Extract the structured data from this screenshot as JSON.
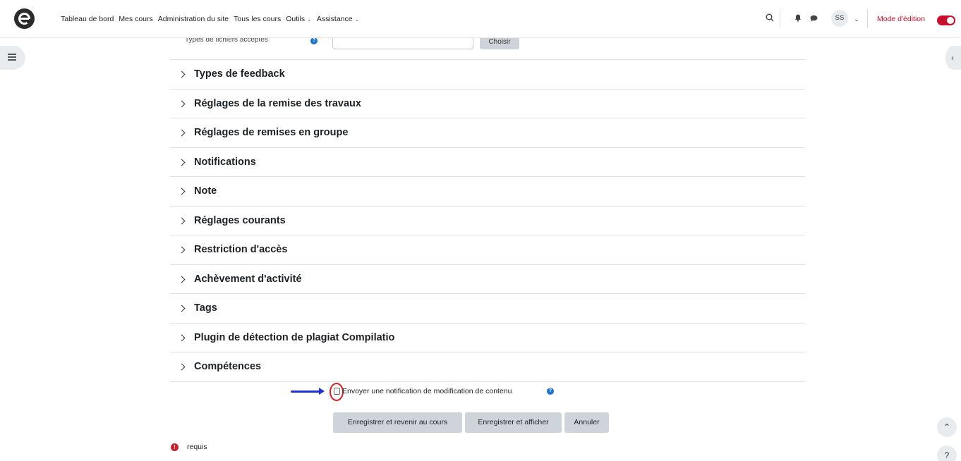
{
  "navbar": {
    "links": [
      "Tableau de bord",
      "Mes cours",
      "Administration du site",
      "Tous les cours",
      "Outils",
      "Assistance"
    ],
    "avatar_initials": "SS",
    "edit_mode_label": "Mode d'édition"
  },
  "partial_field": {
    "label": "Types de fichiers acceptés",
    "button_label": "Choisir"
  },
  "sections": [
    "Types de feedback",
    "Réglages de la remise des travaux",
    "Réglages de remises en groupe",
    "Notifications",
    "Note",
    "Réglages courants",
    "Restriction d'accès",
    "Achèvement d'activité",
    "Tags",
    "Plugin de détection de plagiat Compilatio",
    "Compétences"
  ],
  "notify": {
    "label": "Envoyer une notification de modification de contenu"
  },
  "actions": {
    "save_return": "Enregistrer et revenir au cours",
    "save_show": "Enregistrer et afficher",
    "cancel": "Annuler"
  },
  "required": {
    "label": "requis"
  },
  "colors": {
    "brand_red": "#c8102e",
    "help_blue": "#1b74d2",
    "arrow_blue": "#1f2fd6",
    "annotation_red": "#e01e1e"
  }
}
